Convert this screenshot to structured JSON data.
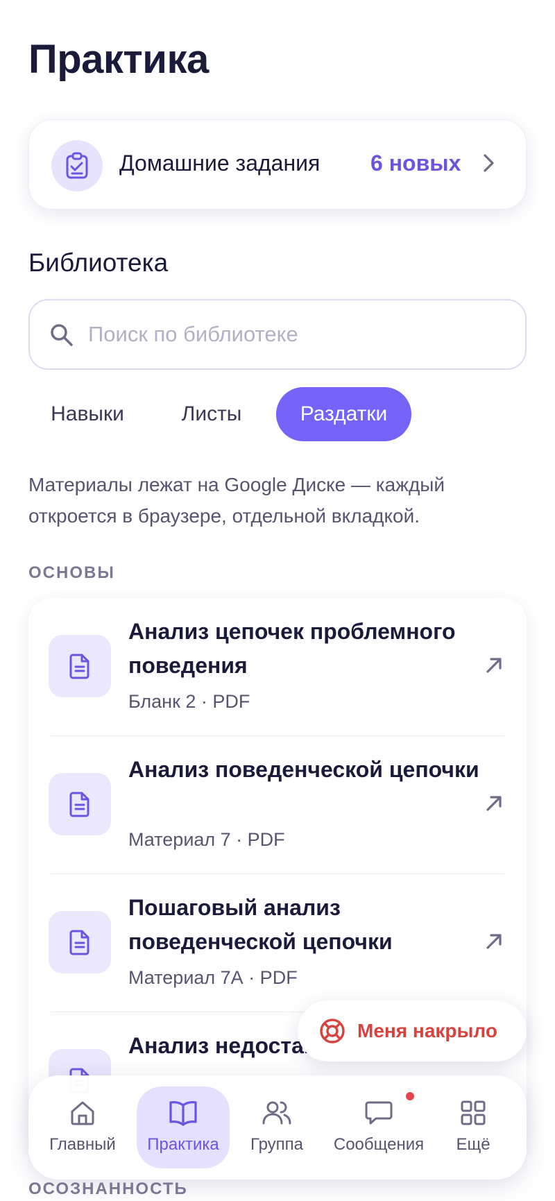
{
  "page": {
    "title": "Практика"
  },
  "homework": {
    "label": "Домашние задания",
    "count": "6 новых"
  },
  "library": {
    "title": "Библиотека",
    "search_placeholder": "Поиск по библиотеке",
    "tabs": [
      {
        "label": "Навыки",
        "active": false
      },
      {
        "label": "Листы",
        "active": false
      },
      {
        "label": "Раздатки",
        "active": true
      }
    ],
    "info": "Материалы лежат на Google Диске — каждый откроется в браузере, отдельной вкладкой."
  },
  "sections": [
    {
      "label": "ОСНОВЫ",
      "items": [
        {
          "title": "Анализ цепочек проблемного поведения",
          "meta": "Бланк 2 · PDF"
        },
        {
          "title": "Анализ поведенческой цепочки",
          "meta": "Материал 7 · PDF"
        },
        {
          "title": "Пошаговый анализ поведенческой цепочки",
          "meta": "Материал 7А · PDF"
        },
        {
          "title": "Анализ недостающих",
          "meta": ""
        }
      ]
    },
    {
      "label": "ОСОЗНАННОСТЬ",
      "items": []
    }
  ],
  "fab": {
    "label": "Меня накрыло"
  },
  "nav": [
    {
      "label": "Главный",
      "icon": "home-icon",
      "active": false
    },
    {
      "label": "Практика",
      "icon": "book-icon",
      "active": true
    },
    {
      "label": "Группа",
      "icon": "users-icon",
      "active": false
    },
    {
      "label": "Сообщения",
      "icon": "chat-icon",
      "active": false,
      "badge": true
    },
    {
      "label": "Ещё",
      "icon": "grid-icon",
      "active": false
    }
  ],
  "colors": {
    "accent": "#7562f7",
    "accent_text": "#6a55e0",
    "danger": "#d8423d",
    "text": "#1c1a3a"
  }
}
